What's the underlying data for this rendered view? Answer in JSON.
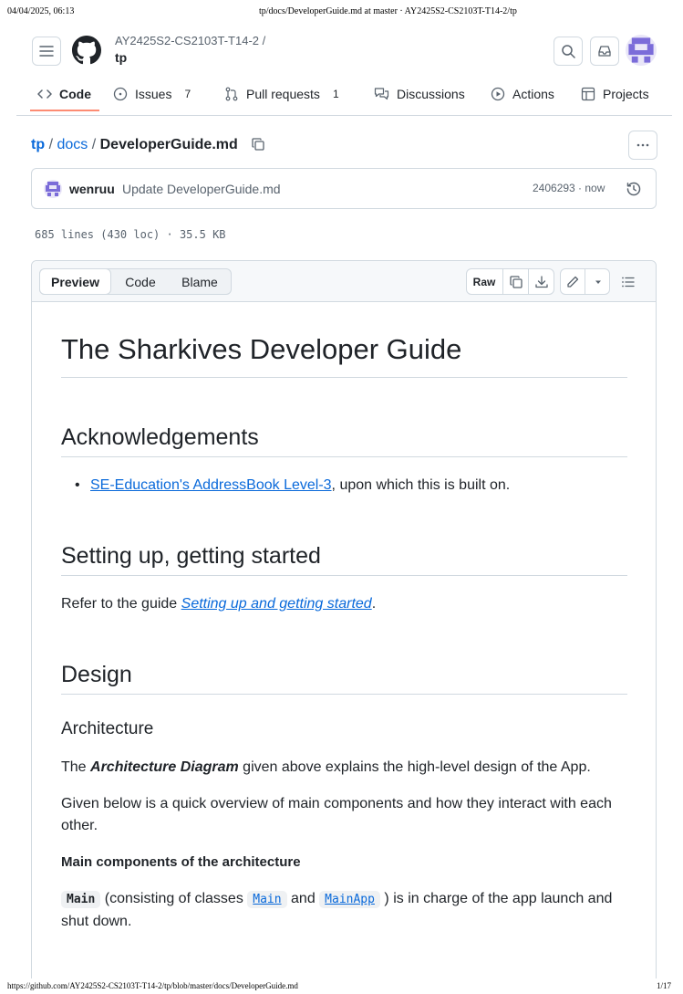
{
  "print_header": {
    "datetime": "04/04/2025, 06:13",
    "title": "tp/docs/DeveloperGuide.md at master · AY2425S2-CS2103T-T14-2/tp"
  },
  "print_footer": {
    "url": "https://github.com/AY2425S2-CS2103T-T14-2/tp/blob/master/docs/DeveloperGuide.md",
    "page": "1/17"
  },
  "header": {
    "owner": "AY2425S2-CS2103T-T14-2 /",
    "repo": "tp"
  },
  "tabs": [
    {
      "label": "Code",
      "icon": "code-icon",
      "active": true
    },
    {
      "label": "Issues",
      "icon": "issue-icon",
      "count": "7"
    },
    {
      "label": "Pull requests",
      "icon": "pull-request-icon",
      "count": "1"
    },
    {
      "label": "Discussions",
      "icon": "discussion-icon"
    },
    {
      "label": "Actions",
      "icon": "play-icon"
    },
    {
      "label": "Projects",
      "icon": "table-icon"
    }
  ],
  "breadcrumb": {
    "root": "tp",
    "sep1": "/",
    "dir": "docs",
    "sep2": "/",
    "file": "DeveloperGuide.md"
  },
  "commit": {
    "author": "wenruu",
    "message": "Update DeveloperGuide.md",
    "meta": "2406293 · now"
  },
  "file_stats": "685 lines (430 loc) · 35.5 KB",
  "toolbar": {
    "preview": "Preview",
    "code": "Code",
    "blame": "Blame",
    "raw": "Raw"
  },
  "doc": {
    "title": "The Sharkives Developer Guide",
    "ack_heading": "Acknowledgements",
    "ack_link": "SE-Education's AddressBook Level-3",
    "ack_rest": ", upon which this is built on.",
    "setup_heading": "Setting up, getting started",
    "setup_pre": "Refer to the guide ",
    "setup_link": "Setting up and getting started",
    "setup_post": ".",
    "design_heading": "Design",
    "arch_heading": "Architecture",
    "arch_p1_pre": "The ",
    "arch_p1_bold": "Architecture Diagram",
    "arch_p1_post": " given above explains the high-level design of the App.",
    "arch_p2": "Given below is a quick overview of main components and how they interact with each other.",
    "main_components": "Main components of the architecture",
    "main_code": "Main",
    "main_p_a": " (consisting of classes ",
    "main_link1": "Main",
    "main_p_b": " and ",
    "main_link2": "MainApp",
    "main_p_c": " ) is in charge of the app launch and shut down."
  }
}
